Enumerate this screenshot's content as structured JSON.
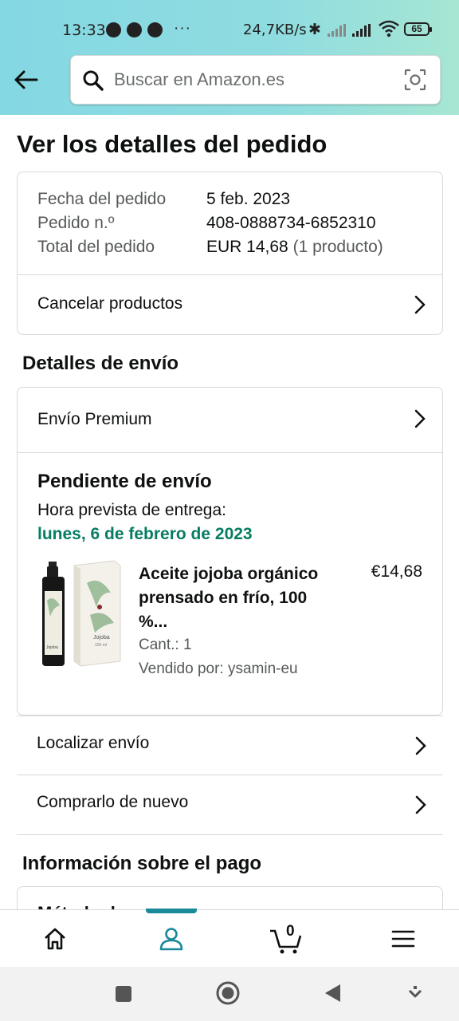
{
  "status_bar": {
    "time": "13:33",
    "dots": "···",
    "network_speed": "24,7KB/s",
    "battery": "65"
  },
  "search": {
    "placeholder": "Buscar en Amazon.es"
  },
  "page_title": "Ver los detalles del pedido",
  "order_summary": {
    "date_label": "Fecha del pedido",
    "date_value": "5 feb. 2023",
    "number_label": "Pedido n.º",
    "number_value": "408-0888734-6852310",
    "total_label": "Total del pedido",
    "total_value": "EUR 14,68",
    "total_count": "(1 producto)",
    "cancel_label": "Cancelar productos"
  },
  "shipping": {
    "section_title": "Detalles de envío",
    "method": "Envío Premium",
    "status": "Pendiente de envío",
    "eta_label": "Hora prevista de entrega:",
    "eta_date": "lunes, 6 de febrero de 2023",
    "product": {
      "name": "Aceite jojoba orgánico prensado en frío, 100 %...",
      "price": "€14,68",
      "quantity": "Cant.: 1",
      "seller": "Vendido por: ysamin-eu"
    },
    "track_label": "Localizar envío",
    "buy_again_label": "Comprarlo de nuevo"
  },
  "payment": {
    "section_title": "Información sobre el pago",
    "partial_text": "Método de pago"
  },
  "bottom_nav": {
    "cart_count": "0",
    "active": "account"
  },
  "colors": {
    "header_gradient_start": "#84d8e3",
    "header_gradient_end": "#a6e6d3",
    "delivery_green": "#067d62",
    "nav_active": "#1a8a9a",
    "text_primary": "#0f1111",
    "text_secondary": "#565959"
  }
}
